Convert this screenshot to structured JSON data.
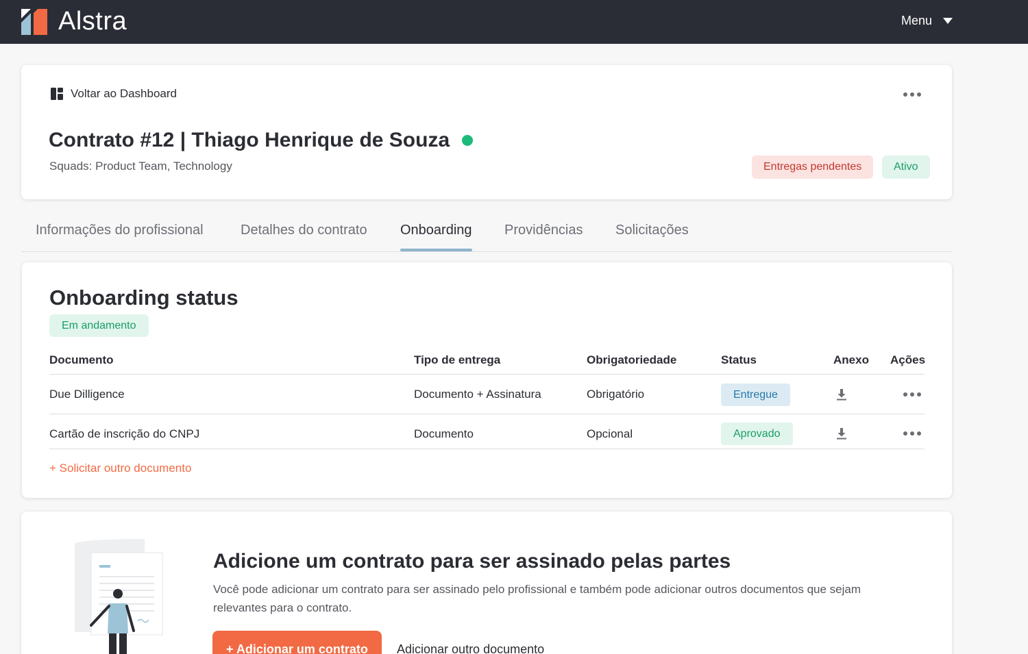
{
  "app": {
    "name": "Alstra",
    "menu_label": "Menu"
  },
  "header": {
    "back_label": "Voltar ao Dashboard",
    "title": "Contrato #12 | Thiago Henrique de Souza",
    "squads": "Squads: Product Team, Technology",
    "badges": {
      "pending": "Entregas pendentes",
      "active": "Ativo"
    }
  },
  "tabs": [
    {
      "label": "Informações do profissional",
      "active": false
    },
    {
      "label": "Detalhes do contrato",
      "active": false
    },
    {
      "label": "Onboarding",
      "active": true
    },
    {
      "label": "Providências",
      "active": false
    },
    {
      "label": "Solicitações",
      "active": false
    }
  ],
  "onboarding": {
    "title": "Onboarding status",
    "status": "Em andamento",
    "columns": [
      "Documento",
      "Tipo de entrega",
      "Obrigatoriedade",
      "Status",
      "Anexo",
      "Ações"
    ],
    "rows": [
      {
        "document": "Due Dilligence",
        "delivery_type": "Documento + Assinatura",
        "requirement": "Obrigatório",
        "status": "Entregue"
      },
      {
        "document": "Cartão de inscrição do CNPJ",
        "delivery_type": "Documento",
        "requirement": "Opcional",
        "status": "Aprovado"
      }
    ],
    "request_link": "+ Solicitar outro documento"
  },
  "contract_cta": {
    "title": "Adicione um contrato para ser assinado pelas partes",
    "description": "Você pode adicionar um contrato para ser assinado pelo profissional e também pode adicionar outros documentos que sejam relevantes para o contrato.",
    "add_button": "+ Adicionar um contrato",
    "other_button": "Adicionar outro documento"
  },
  "colors": {
    "accent": "#f26a43",
    "topbar": "#2a2d36",
    "success": "#1dbb7b"
  }
}
